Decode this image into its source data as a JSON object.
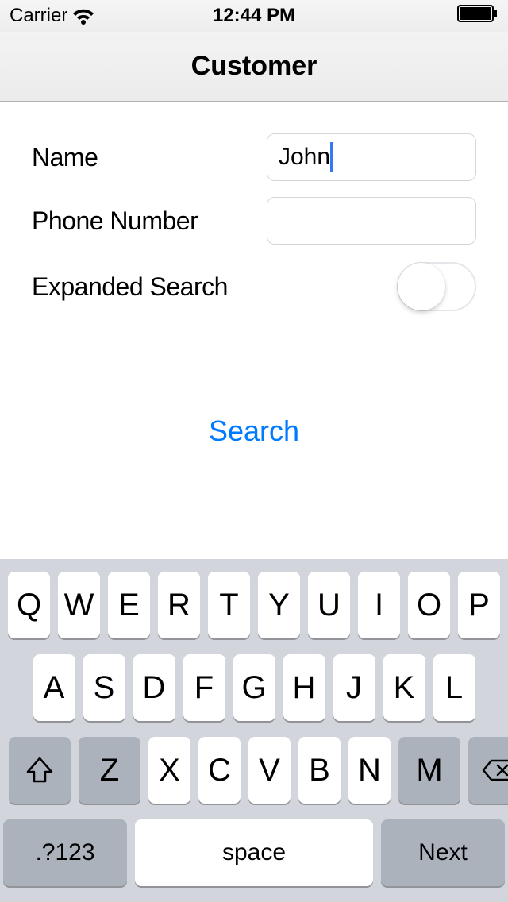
{
  "statusBar": {
    "carrier": "Carrier",
    "time": "12:44 PM"
  },
  "nav": {
    "title": "Customer"
  },
  "form": {
    "nameLabel": "Name",
    "nameValue": "John",
    "phoneLabel": "Phone Number",
    "phoneValue": "",
    "expandedLabel": "Expanded Search",
    "expandedOn": false
  },
  "actions": {
    "search": "Search"
  },
  "keyboard": {
    "row1": [
      "Q",
      "W",
      "E",
      "R",
      "T",
      "Y",
      "U",
      "I",
      "O",
      "P"
    ],
    "row2": [
      "A",
      "S",
      "D",
      "F",
      "G",
      "H",
      "J",
      "K",
      "L"
    ],
    "row3": [
      "Z",
      "X",
      "C",
      "V",
      "B",
      "N",
      "M"
    ],
    "numKey": ".?123",
    "space": "space",
    "next": "Next"
  }
}
